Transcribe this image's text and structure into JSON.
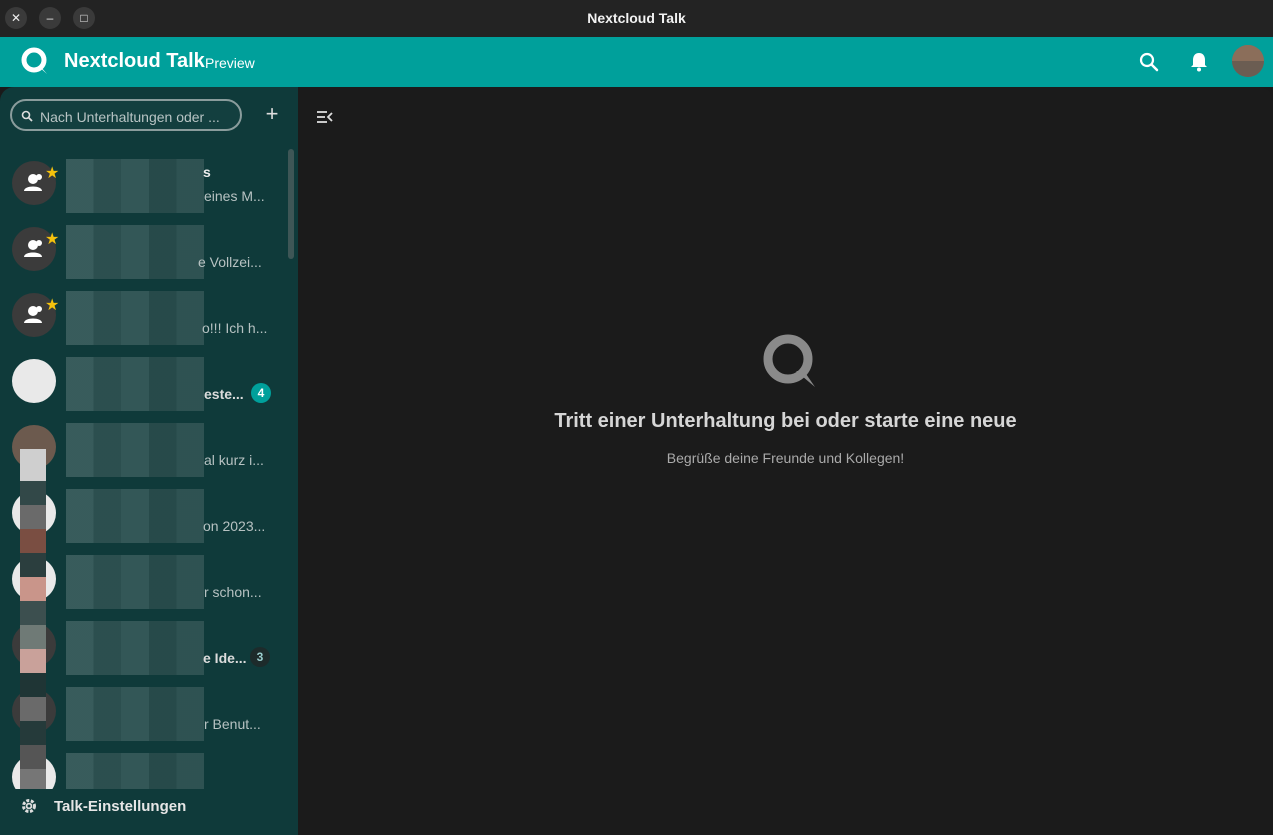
{
  "window": {
    "title": "Nextcloud Talk",
    "close_glyph": "✕",
    "minimize_glyph": "–",
    "maximize_glyph": "□"
  },
  "header": {
    "app_name": "Nextcloud Talk",
    "badge": "Preview",
    "icons": [
      "search-icon",
      "bell-icon",
      "user-avatar"
    ],
    "color": "#00a09b"
  },
  "sidebar": {
    "search_placeholder": "Nach Unterhaltungen oder ...",
    "add_glyph": "+",
    "conversations": [
      {
        "name_suffix": "s",
        "preview": "eines M...",
        "favorite": true,
        "icon": "group-icon"
      },
      {
        "name_suffix": "",
        "preview": "e Vollzei...",
        "favorite": true,
        "icon": "group-icon"
      },
      {
        "name_suffix": "",
        "preview": "o!!! Ich h...",
        "favorite": true,
        "icon": "group-icon"
      },
      {
        "name_suffix": "",
        "preview": "este...",
        "favorite": false,
        "unread": "4",
        "bold": true
      },
      {
        "name_suffix": "",
        "preview": "al kurz i...",
        "favorite": false
      },
      {
        "name_suffix": "",
        "preview": "on 2023...",
        "favorite": false
      },
      {
        "name_suffix": "",
        "preview": "r schon...",
        "favorite": false
      },
      {
        "name_suffix": "",
        "preview": "e Ide...",
        "favorite": false,
        "unread": "3",
        "bold": true
      },
      {
        "name_suffix": "",
        "preview": "r Benut...",
        "favorite": false
      },
      {
        "name_suffix": "",
        "preview": "",
        "favorite": false
      }
    ],
    "settings_label": "Talk-Einstellungen"
  },
  "main": {
    "empty_title": "Tritt einer Unterhaltung bei oder starte eine neue",
    "empty_subtitle": "Begrüße deine Freunde und Kollegen!"
  }
}
